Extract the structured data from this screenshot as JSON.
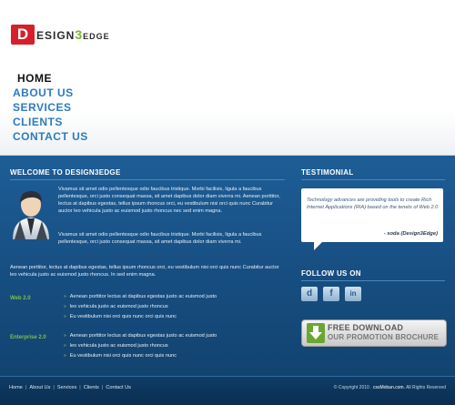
{
  "logo": {
    "initial": "D",
    "rest_a": "ESIGN",
    "rest_b": "3",
    "rest_c": "EDGE"
  },
  "nav": {
    "items": [
      "HOME",
      "ABOUT US",
      "SERVICES",
      "CLIENTS",
      "CONTACT US"
    ],
    "active": "HOME"
  },
  "welcome": {
    "title": "WELCOME TO DESIGN3EDGE",
    "para1": "Vivamus sit amet odio pellentesque odio faucibus tristique. Morbi facilisis, ligula a faucibus pellentesque, orci justo consequat massa, sit amet dapibus dolor diam viverra mi. Aenean porttitor, lectus at dapibus egestas, tellus ipsum rhoncus orci, eu vestibulum nisi orci quis nunc Curabitur auctor leo vehicula justo ac euismod justo rhoncus nec sed enim magna.",
    "para2": "Vivamus sit amet odio pellentesque odio faucibus tristique. Morbi facilisis, ligula a faucibus pellentesque, orci justo consequat massa, sit amet dapibus dolor diam viverra mi.",
    "para3": "Aenean porttitor, lectus at dapibus egestas, tellus ipsum rhoncus orci, eu vestibulum nisi orci quis nunc Curabitur auctor leo vehicula justo ac euismod justo rhoncus. In sed enim magna.",
    "web_label": "Web 2.0",
    "web_items": [
      "Aenean porttitor lectus at dapibus egestas justo ac euismod justo",
      "leo vehicula justo ac euismod justo rhoncus",
      "Eu vestibulum nisi orci quis nunc orci quis nunc"
    ],
    "enterprise_label": "Enterprise 2.0",
    "enterprise_items": [
      "Aenean porttitor lectus at dapibus egestas justo ac euismod justo",
      "leo vehicula justo ac euismod justo rhoncus",
      "Eu vestibulum nisi orci quis nunc orci quis nunc"
    ]
  },
  "testimonial": {
    "title": "TESTIMONIAL",
    "text": "Technology advances are providing tools to create Rich Internet Applications (RIA) based on the tenets of Web 2.0",
    "author": "- soda (Design3Edge)"
  },
  "follow": {
    "title": "FOLLOW US ON",
    "icons": [
      "digg-icon",
      "facebook-icon",
      "linkedin-icon"
    ],
    "glyphs": [
      "d",
      "f",
      "in"
    ]
  },
  "download": {
    "line1": "FREE DOWNLOAD",
    "line2": "OUR PROMOTION BROCHURE"
  },
  "footer": {
    "links": [
      "Home",
      "About Us",
      "Services",
      "Clients",
      "Contact Us"
    ],
    "copyright": "© Copyright 2010 .",
    "site": "cssMoban.com",
    "rights": ". All Rights Reserved"
  },
  "colors": {
    "accent_blue": "#2c7bbf",
    "logo_red": "#d5202b",
    "logo_green": "#76b82a",
    "category_green": "#7fc04a"
  }
}
